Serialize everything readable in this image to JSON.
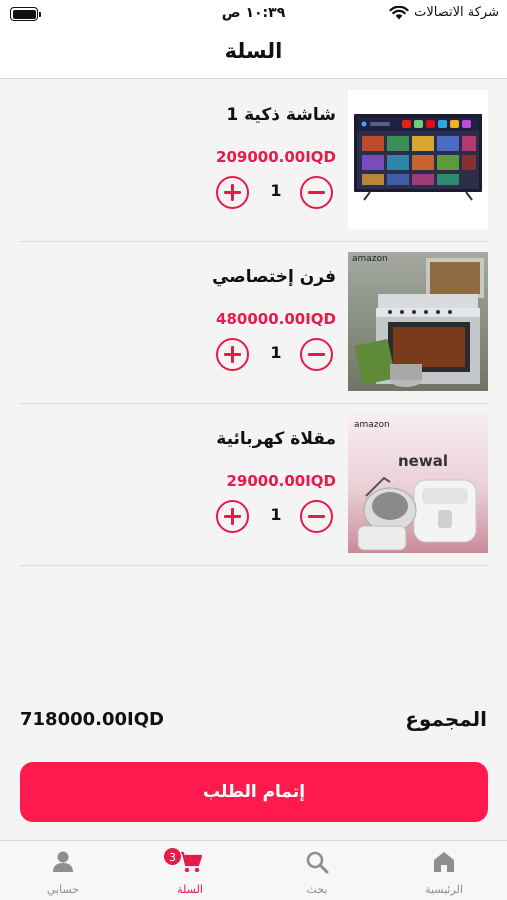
{
  "status_bar": {
    "carrier": "شركة الاتصالات",
    "time": "١٠:٣٩ ص"
  },
  "header": {
    "title": "السلة"
  },
  "cart": {
    "items": [
      {
        "name": "شاشة ذكية 1",
        "price": "209000.00IQD",
        "quantity": "1",
        "image": "smart-tv-image"
      },
      {
        "name": "فرن إختصاصي",
        "price": "480000.00IQD",
        "quantity": "1",
        "image": "gas-oven-image"
      },
      {
        "name": "مقلاة كهربائية",
        "price": "29000.00IQD",
        "quantity": "1",
        "image": "electric-fryer-image"
      }
    ],
    "oven_image_brand": "amazon",
    "fryer_image_brand": "amazon",
    "fryer_image_product_brand": "newal"
  },
  "summary": {
    "total_label": "المجموع",
    "total_amount": "718000.00IQD"
  },
  "checkout": {
    "label": "إتمام الطلب"
  },
  "tab_bar": {
    "tabs": [
      {
        "label": "الرئيسية",
        "icon": "home-icon"
      },
      {
        "label": "بحث",
        "icon": "search-icon"
      },
      {
        "label": "السلة",
        "icon": "cart-icon",
        "badge": "3",
        "active": true
      },
      {
        "label": "حسابي",
        "icon": "user-icon"
      }
    ]
  },
  "colors": {
    "accent": "#e8194b",
    "checkout_button": "#ff1a4d",
    "inactive_tab": "#8e8e93"
  }
}
